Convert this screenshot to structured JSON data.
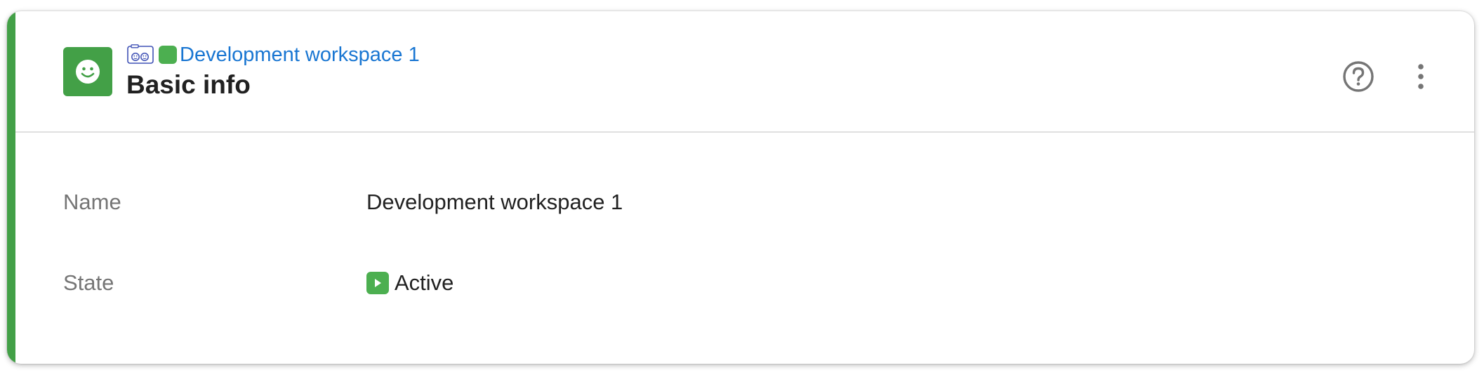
{
  "header": {
    "breadcrumb": {
      "type_icon": "workspace-type-icon",
      "status_icon": "green-status-square-icon",
      "link_label": "Development workspace 1"
    },
    "title": "Basic info",
    "avatar_icon": "smiley-face-icon",
    "actions": {
      "help_icon": "help-circle-icon",
      "more_icon": "more-vertical-icon"
    }
  },
  "fields": [
    {
      "label": "Name",
      "value": "Development workspace 1"
    },
    {
      "label": "State",
      "value": "Active",
      "icon": "play-icon"
    }
  ],
  "colors": {
    "accent": "#43a047",
    "status_active": "#4caf50",
    "link": "#1976d2",
    "label_text": "#757575",
    "value_text": "#212121"
  }
}
